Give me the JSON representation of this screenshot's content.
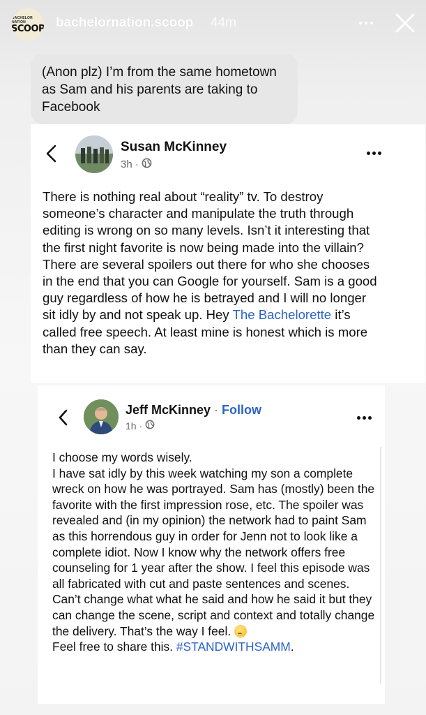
{
  "story_header": {
    "avatar_small_text": "BACHELOR NATION",
    "avatar_big_text": "SCOOP",
    "username": "bachelornation.scoop",
    "time": "44m"
  },
  "bubble": {
    "text": "(Anon plz) I’m from the same hometown as Sam and his parents are taking to Facebook"
  },
  "post1": {
    "author": "Susan McKinney",
    "time": "3h",
    "body_before_link": "There is nothing real about “reality” tv. To destroy someone’s character and manipulate the truth through editing is wrong on so many levels. Isn’t it interesting that the first night favorite is now being made into the villain? There are several spoilers out there for who she chooses in the end that you can Google for yourself. Sam is a good guy regardless of how he is betrayed and I will no longer sit idly by and not speak up. Hey ",
    "link_text": "The Bachelorette",
    "body_after_link": " it’s called free speech. At least mine is honest which is more than they can say."
  },
  "post2": {
    "author": "Jeff McKinney",
    "separator": " · ",
    "follow_label": "Follow",
    "time": "1h",
    "line1": "I choose my words wisely.",
    "body": "I have sat idly by this week watching my son a complete wreck on how he was portrayed. Sam has (mostly) been the favorite with the first impression rose, etc. The spoiler was revealed and (in my opinion) the network had to paint Sam as this horrendous guy in order for Jenn not to look like a complete idiot. Now I know why the network offers free counseling for 1  year after the show. I feel this episode was all fabricated with cut and paste sentences and scenes. Can’t change what what he said and how he said it but they can change the scene, script and context and totally change the delivery. That’s the way I feel. ",
    "share_text": "Feel free to share this. ",
    "hashtag": "#STANDWITHSAMM",
    "end": "."
  },
  "icons": {
    "more": "more-icon",
    "close": "close-icon",
    "back": "chevron-left-icon",
    "globe": "globe-icon",
    "emoji": "thinking-face-emoji"
  },
  "colors": {
    "link": "#2c64c6",
    "meta": "#65676b",
    "bubble": "#e7e7e8"
  }
}
